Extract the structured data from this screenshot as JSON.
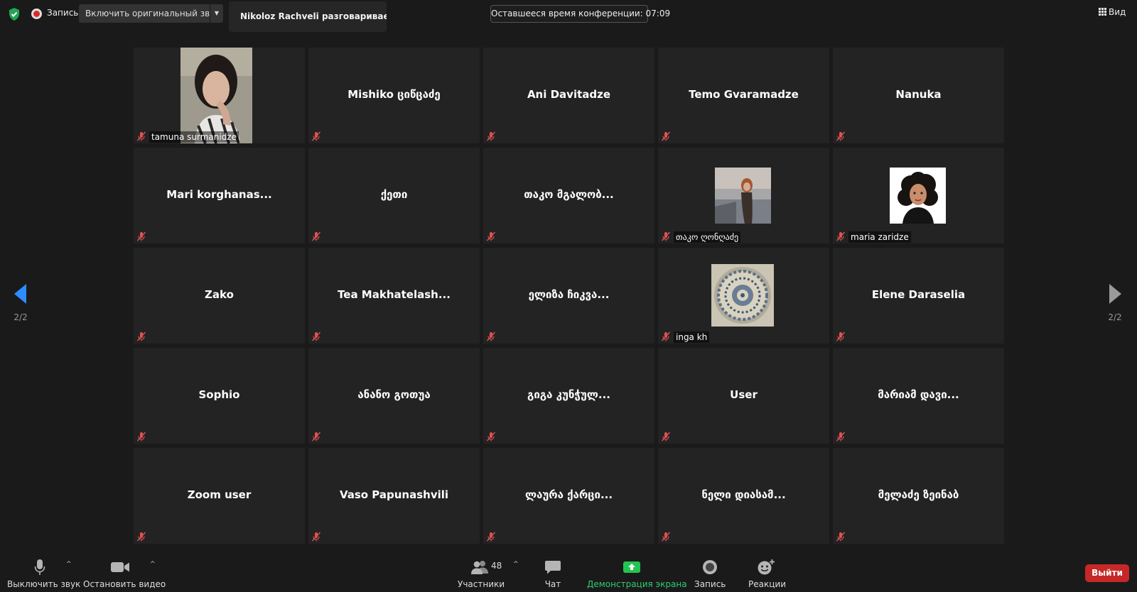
{
  "top_bar": {
    "record_label": "Запись",
    "original_sound_button": "Включить оригинальный звук",
    "active_speaker": "Nikoloz Rachveli разговаривает...",
    "time_remaining": "Оставшееся время конференции: 07:09",
    "view_label": "Вид"
  },
  "pager": {
    "left_page": "2/2",
    "right_page": "2/2"
  },
  "tiles": [
    {
      "name": "tamuna surmanidze",
      "kind": "photo",
      "photo": "person-woman-dark-hair"
    },
    {
      "name": "Mishiko ციწცაძე",
      "kind": "text"
    },
    {
      "name": "Ani Davitadze",
      "kind": "text"
    },
    {
      "name": "Temo Gvaramadze",
      "kind": "text"
    },
    {
      "name": "Nanuka",
      "kind": "text"
    },
    {
      "name": "Mari  korghanas...",
      "kind": "text"
    },
    {
      "name": "ქეთი",
      "kind": "text"
    },
    {
      "name": "თაკო  მგალობ...",
      "kind": "text"
    },
    {
      "name": "თაკო ღონღაძე",
      "kind": "photo",
      "photo": "woman-outdoors"
    },
    {
      "name": "maria zaridze",
      "kind": "photo",
      "photo": "cartoon-woman-curly-hair"
    },
    {
      "name": "Zako",
      "kind": "text"
    },
    {
      "name": "Tea  Makhatelash...",
      "kind": "text"
    },
    {
      "name": "ელიზა  ჩიკვა...",
      "kind": "text"
    },
    {
      "name": "inga kh",
      "kind": "photo",
      "photo": "mandala-ornament"
    },
    {
      "name": "Elene Daraselia",
      "kind": "text"
    },
    {
      "name": "Sophio",
      "kind": "text"
    },
    {
      "name": "ანანო გოთუა",
      "kind": "text"
    },
    {
      "name": "გიგა  კუნჭულ...",
      "kind": "text"
    },
    {
      "name": "User",
      "kind": "text"
    },
    {
      "name": "მარიამ  დავი...",
      "kind": "text"
    },
    {
      "name": "Zoom user",
      "kind": "text"
    },
    {
      "name": "Vaso Papunashvili",
      "kind": "text"
    },
    {
      "name": "ლაურა  ქარცი...",
      "kind": "text"
    },
    {
      "name": "ნელი  დიასამ...",
      "kind": "text"
    },
    {
      "name": "მელაძე ზეინაბ",
      "kind": "text"
    }
  ],
  "toolbar": {
    "mute_label": "Выключить звук",
    "video_label": "Остановить видео",
    "participants_label": "Участники",
    "participants_count": "48",
    "chat_label": "Чат",
    "share_label": "Демонстрация экрана",
    "record_label": "Запись",
    "reactions_label": "Реакции",
    "leave_label": "Выйти"
  },
  "colors": {
    "background": "#1a1a1a",
    "tile": "#232323",
    "accent_blue": "#2d8cff",
    "share_green": "#2ecc71",
    "leave_red": "#c62828",
    "muted_red": "#e05252"
  }
}
